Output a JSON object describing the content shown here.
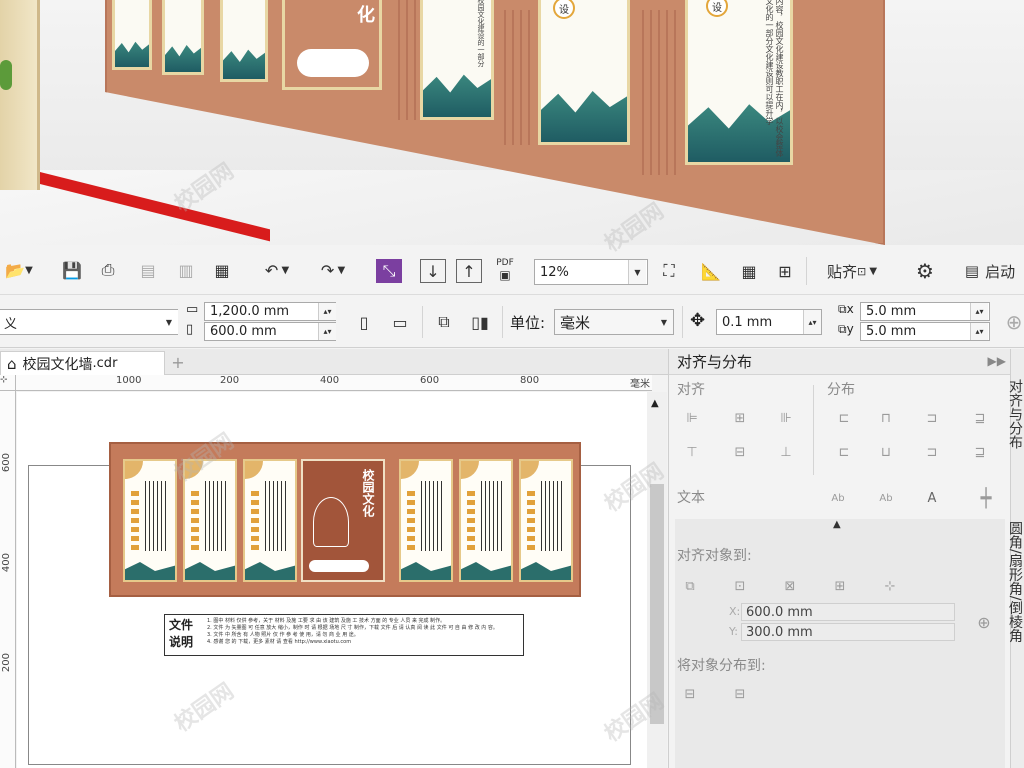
{
  "render": {
    "badge_left": "设",
    "badge_right": "设",
    "panel_text_right": "内容，校园文化建设教职工在内，以校会整体文化的一部分文化建设则可以提升学",
    "panel_text_left": "校园文化建设的一部分",
    "center_glyph": "化"
  },
  "toolbar1": {
    "pdf_label": "PDF",
    "zoom_value": "12%",
    "snap_label": "贴齐",
    "launch_label": "启动"
  },
  "toolbar2": {
    "page_preset": "义",
    "width_value": "1,200.0 mm",
    "height_value": "600.0 mm",
    "unit_label": "单位:",
    "unit_value": "毫米",
    "nudge_value": "0.1 mm",
    "dup_x": "5.0 mm",
    "dup_y": "5.0 mm"
  },
  "document": {
    "tab_title": "校园文化墙",
    "tab_ext": ".cdr"
  },
  "ruler": {
    "h_ticks": [
      "200",
      "400",
      "600",
      "800",
      "1000"
    ],
    "h_unit": "毫米",
    "v_ticks": [
      "600",
      "400",
      "200"
    ]
  },
  "design": {
    "center_title": "校园文化",
    "note_title": "文件说明",
    "note_lines": [
      "1. 图中 材料 仅供 参考，关于 材料 及施 工要 求 由 该 建筑 及施 工 技术 方面 的 专业 人员 来 完成 制作。",
      "2. 文件 为 矢量图 可 任意 放大 缩小，制作 时 请 根据 场地 尺 寸 制作，下载 文件 后 请 认真 阅 读 此 文件 可 自 由 修 改 内 容。",
      "3. 文件 中 所含 有 人物 照片 仅 作 参 考 使 用，请 勿 商 业 用 途。",
      "4. 感谢 您 的 下载，更多 素材 请 查看 http://www.xiaotu.com"
    ]
  },
  "docker": {
    "title": "对齐与分布",
    "align_section": "对齐",
    "distribute_section": "分布",
    "text_section": "文本",
    "align_to_section": "对齐对象到:",
    "x_label": "X:",
    "x_value": "600.0 mm",
    "y_label": "Y:",
    "y_value": "300.0 mm",
    "distribute_to_section": "将对象分布到:"
  },
  "vtabs": {
    "tab1": "对齐与分布",
    "tab2": "圆角/扇形角/倒棱角"
  },
  "watermark": "校园网"
}
